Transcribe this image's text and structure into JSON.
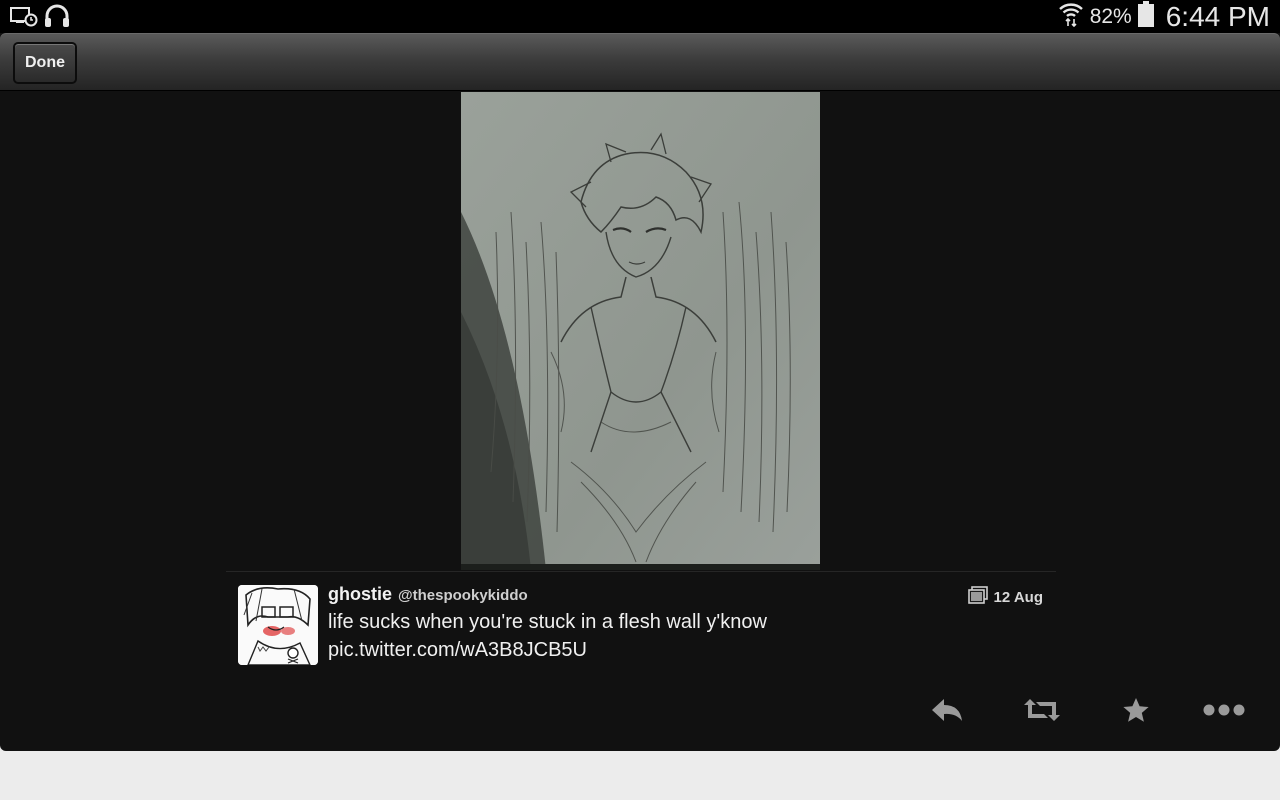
{
  "status": {
    "battery_pct": "82%",
    "time": "6:44 PM",
    "left_icons": [
      "screen-timer-icon",
      "headphones-icon"
    ],
    "right_icons": [
      "wifi-sync-icon",
      "battery-icon"
    ]
  },
  "toolbar": {
    "done_label": "Done"
  },
  "media": {
    "description_icon": "tweet-photo-sketch"
  },
  "tweet": {
    "name": "ghostie",
    "handle": "@thespookykiddo",
    "text": "life sucks when you're stuck in a flesh wall y'know",
    "link": "pic.twitter.com/wA3B8JCB5U",
    "date": "12 Aug",
    "date_icon": "photo-stack-icon"
  },
  "actions": [
    {
      "name": "reply-icon"
    },
    {
      "name": "retweet-icon"
    },
    {
      "name": "favorite-star-icon"
    },
    {
      "name": "more-options-icon"
    }
  ],
  "colors": {
    "app_bg": "#111111",
    "toolbar_top": "#5a5a5a",
    "toolbar_bottom": "#242424",
    "icon_gray": "#9a9a9a"
  }
}
